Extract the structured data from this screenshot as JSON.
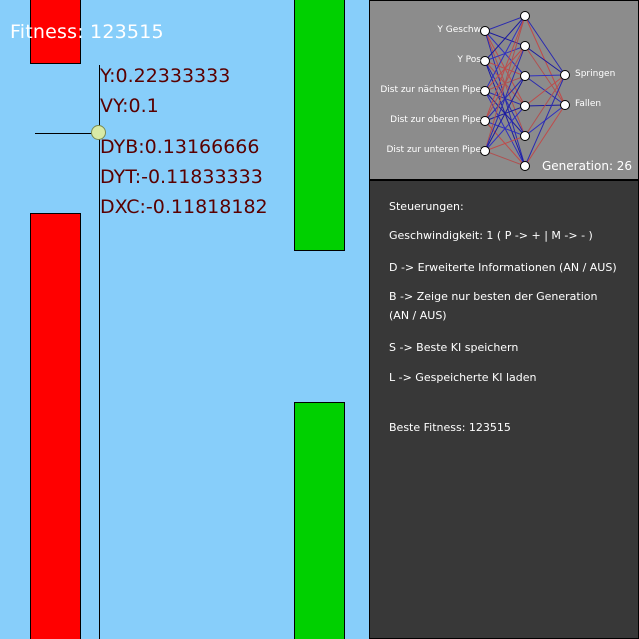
{
  "game": {
    "fitness_label": "Fitness: 123515",
    "info": {
      "y": "Y:0.22333333",
      "vy": "VY:0.1",
      "dyb": "DYB:0.13166666",
      "dyt": "DYT:-0.11833333",
      "dxc": "DXC:-0.11818182"
    },
    "colors": {
      "sky": "#87cefa",
      "pipe_active": "#ff0000",
      "pipe_next": "#00d000"
    }
  },
  "network": {
    "inputs": [
      "Y Geschw",
      "Y Pos",
      "Dist zur nächsten Pipe",
      "Dist zur oberen Pipe",
      "Dist zur unteren Pipe"
    ],
    "outputs": [
      "Springen",
      "Fallen"
    ],
    "generation_label": "Generation: 26"
  },
  "panel": {
    "title": "Steuerungen:",
    "speed": "Geschwindigkeit: 1  ( P -> +  |  M -> - )",
    "d_key": "D -> Erweiterte Informationen (AN / AUS)",
    "b_key_line1": "B -> Zeige nur besten der Generation",
    "b_key_line2": "(AN / AUS)",
    "s_key": "S -> Beste KI speichern",
    "l_key": "L -> Gespeicherte KI laden",
    "best_fitness": "Beste Fitness: 123515"
  }
}
